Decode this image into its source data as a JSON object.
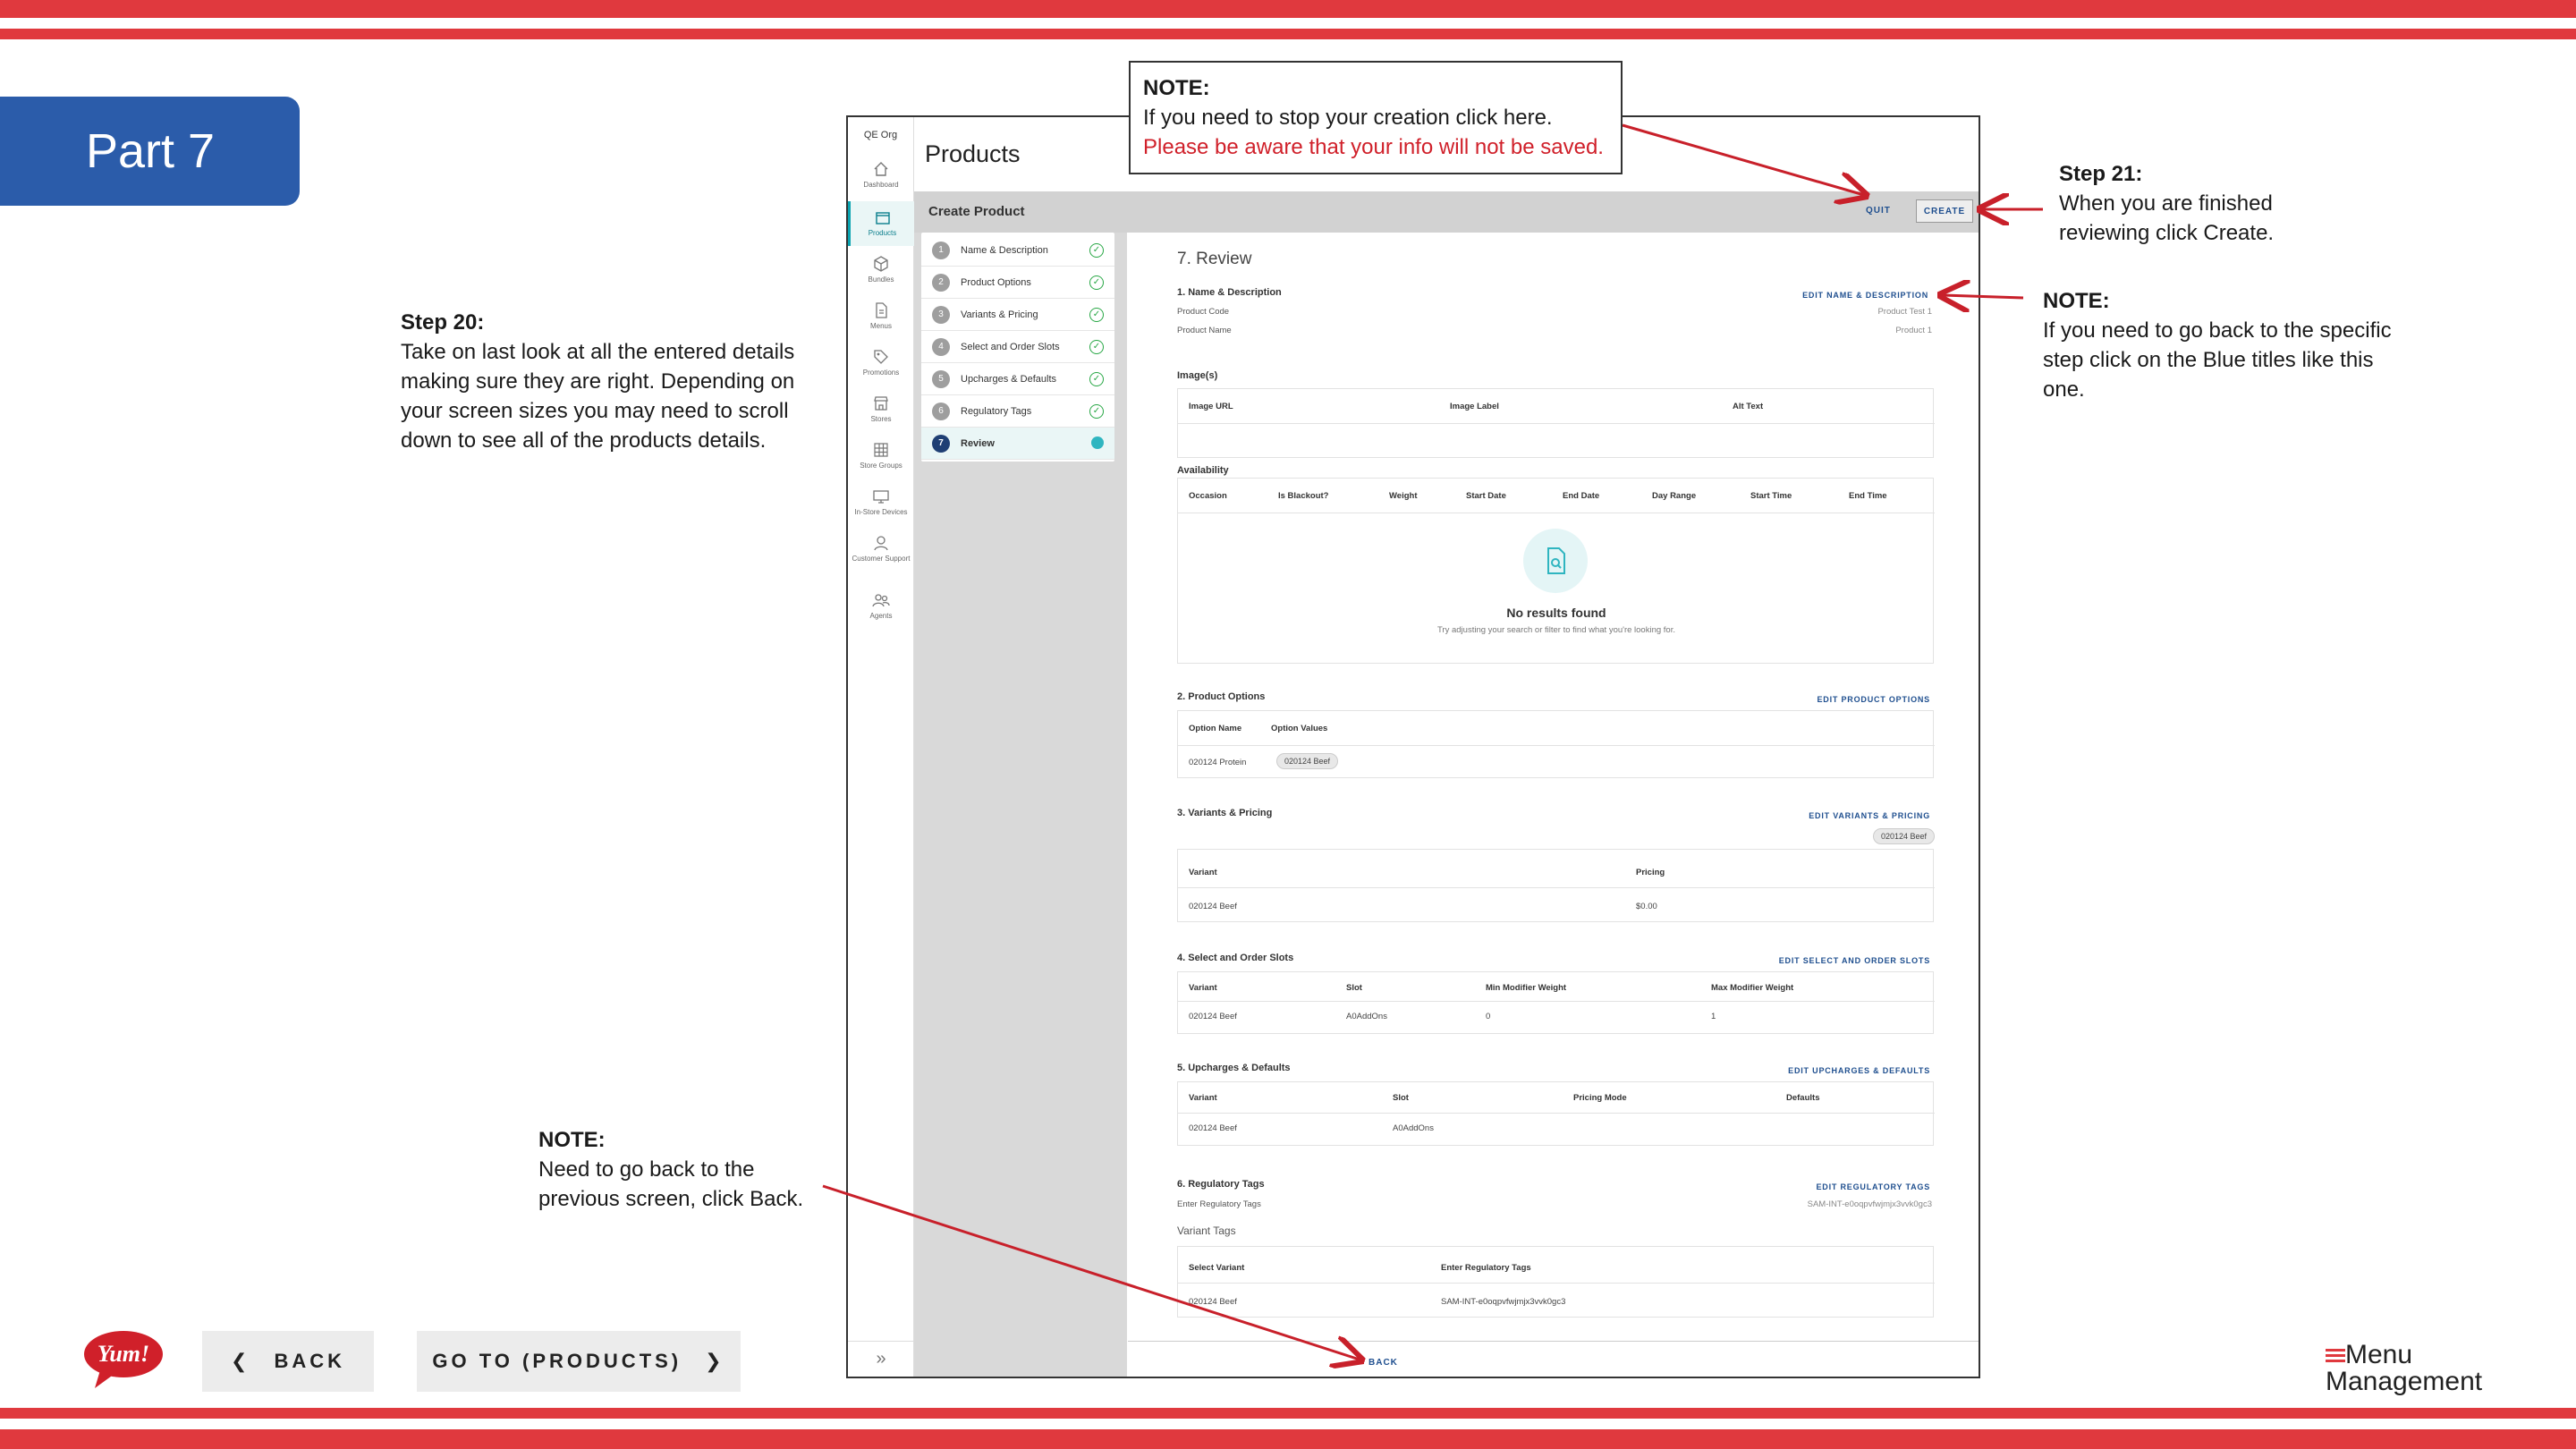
{
  "slide": {
    "part_label": "Part 7",
    "step20_title": "Step 20:",
    "step20_text": "Take on last look at all the entered details making sure they are right. Depending on your screen sizes you may need to scroll down to see all of the products details.",
    "note_top_title": "NOTE:",
    "note_top_line1": "If you need to stop your creation click here.",
    "note_top_line2": "Please be aware that your info will not be saved.",
    "step21_title": "Step 21:",
    "step21_text": "When you are finished reviewing click Create.",
    "note_right_title": "NOTE:",
    "note_right_text": "If you need to go back to the specific step click on the Blue titles like this one.",
    "note_bottom_title": "NOTE:",
    "note_bottom_text": "Need to go back to the previous screen, click Back.",
    "back_button": "BACK",
    "goto_button": "GO TO (PRODUCTS)",
    "brand_line1": "Menu",
    "brand_line2": "Management",
    "logo_text": "Yum!"
  },
  "app": {
    "org": "QE Org",
    "page_title": "Products",
    "rail": [
      {
        "label": "Dashboard",
        "icon": "home-icon"
      },
      {
        "label": "Products",
        "icon": "box-icon"
      },
      {
        "label": "Bundles",
        "icon": "cube-icon"
      },
      {
        "label": "Menus",
        "icon": "document-icon"
      },
      {
        "label": "Promotions",
        "icon": "tag-icon"
      },
      {
        "label": "Stores",
        "icon": "store-icon"
      },
      {
        "label": "Store Groups",
        "icon": "grid-icon"
      },
      {
        "label": "In-Store Devices",
        "icon": "monitor-icon"
      },
      {
        "label": "Customer Support",
        "icon": "support-icon"
      },
      {
        "label": "Agents",
        "icon": "users-icon"
      }
    ],
    "header_title": "Create Product",
    "quit": "QUIT",
    "create": "CREATE",
    "steps": [
      {
        "num": "1",
        "label": "Name & Description"
      },
      {
        "num": "2",
        "label": "Product Options"
      },
      {
        "num": "3",
        "label": "Variants & Pricing"
      },
      {
        "num": "4",
        "label": "Select and Order Slots"
      },
      {
        "num": "5",
        "label": "Upcharges & Defaults"
      },
      {
        "num": "6",
        "label": "Regulatory Tags"
      },
      {
        "num": "7",
        "label": "Review"
      }
    ],
    "review": {
      "title": "7. Review",
      "s1": {
        "heading": "1. Name & Description",
        "edit": "EDIT NAME & DESCRIPTION",
        "code_label": "Product Code",
        "code_value": "Product Test 1",
        "name_label": "Product Name",
        "name_value": "Product 1"
      },
      "images": {
        "heading": "Image(s)",
        "cols": [
          "Image URL",
          "Image Label",
          "Alt Text"
        ]
      },
      "availability": {
        "heading": "Availability",
        "cols": [
          "Occasion",
          "Is Blackout?",
          "Weight",
          "Start Date",
          "End Date",
          "Day Range",
          "Start Time",
          "End Time"
        ],
        "empty_title": "No results found",
        "empty_sub": "Try adjusting your search or filter to find what you're looking for."
      },
      "s2": {
        "heading": "2. Product Options",
        "edit": "EDIT PRODUCT OPTIONS",
        "cols": [
          "Option Name",
          "Option Values"
        ],
        "row": [
          "020124 Protein",
          "020124 Beef"
        ]
      },
      "s3": {
        "heading": "3. Variants & Pricing",
        "edit": "EDIT VARIANTS & PRICING",
        "chip": "020124 Beef",
        "cols": [
          "Variant",
          "Pricing"
        ],
        "row": [
          "020124 Beef",
          "$0.00"
        ]
      },
      "s4": {
        "heading": "4. Select and Order Slots",
        "edit": "EDIT SELECT AND ORDER SLOTS",
        "cols": [
          "Variant",
          "Slot",
          "Min Modifier Weight",
          "Max Modifier Weight"
        ],
        "row": [
          "020124 Beef",
          "A0AddOns",
          "0",
          "1"
        ]
      },
      "s5": {
        "heading": "5. Upcharges & Defaults",
        "edit": "EDIT UPCHARGES & DEFAULTS",
        "cols": [
          "Variant",
          "Slot",
          "Pricing Mode",
          "Defaults"
        ],
        "row": [
          "020124 Beef",
          "A0AddOns",
          "",
          ""
        ]
      },
      "s6": {
        "heading": "6. Regulatory Tags",
        "edit": "EDIT REGULATORY TAGS",
        "tags_label": "Enter Regulatory Tags",
        "tags_value": "SAM-INT-e0oqpvfwjmjx3vvk0gc3",
        "variant_tags": "Variant Tags",
        "cols": [
          "Select Variant",
          "Enter Regulatory Tags"
        ],
        "row": [
          "020124 Beef",
          "SAM-INT-e0oqpvfwjmjx3vvk0gc3"
        ]
      },
      "back": "BACK"
    }
  },
  "colors": {
    "stripe": "#e0393e",
    "badge": "#2b5caa",
    "link": "#1f4f8f",
    "arrow": "#c8202a"
  }
}
